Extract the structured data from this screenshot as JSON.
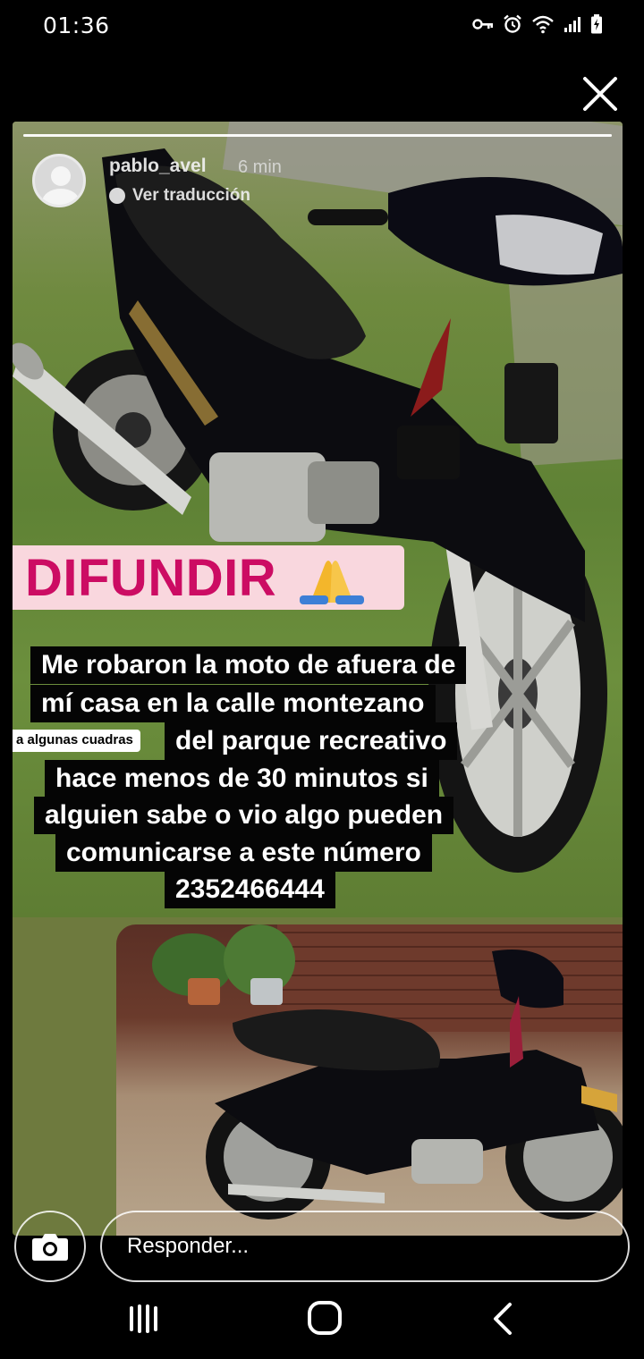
{
  "status_bar": {
    "time": "01:36",
    "icons": [
      "key-icon",
      "alarm-icon",
      "wifi-icon",
      "signal-icon",
      "battery-icon"
    ]
  },
  "story": {
    "username": "pablo_avel",
    "time_ago": "6 min",
    "translate_label": "Ver traducción",
    "progress": 1.0,
    "difundir_label": "DIFUNDIR",
    "message_lines": [
      "Me robaron la moto de afuera de",
      "mí casa en la calle montezano",
      "del parque recreativo",
      "hace menos de 30 minutos si",
      "alguien sabe o vio algo pueden",
      "comunicarse a este número",
      "2352466444"
    ],
    "note_label": "a algunas cuadras"
  },
  "reply": {
    "placeholder": "Responder..."
  },
  "colors": {
    "difundir_text": "#cc0c63",
    "difundir_bg": "#f9d7de",
    "text_bg": "#050505"
  }
}
